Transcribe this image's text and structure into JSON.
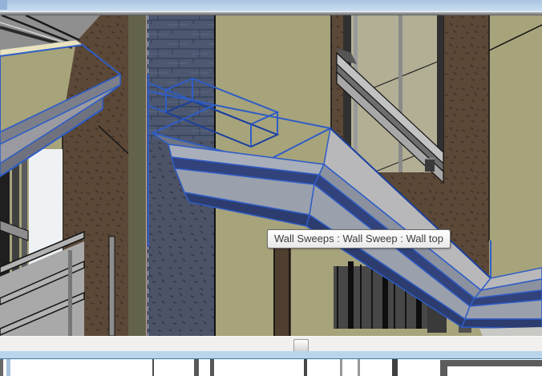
{
  "tooltip": {
    "text": "Wall Sweeps : Wall Sweep : Wall top"
  },
  "scrollbar": {
    "orientation": "horizontal",
    "thumb_position": "center"
  },
  "selection": {
    "category": "Wall Sweeps",
    "family": "Wall Sweep",
    "type": "Wall top"
  },
  "colors": {
    "selection_blue": "#2e5dc6",
    "selection_blue_dark": "#1b3f9c",
    "sky_top": "#a9c3e0",
    "sky_bottom": "#cadef2",
    "top_band_gray": "#8e9195",
    "wall_olive": "#a7a37b",
    "wall_olive_dark": "#63624a",
    "wall_brown": "#5b4837",
    "pier_blue_gray": "#4d5366",
    "surface_gray": "#b0b0b2",
    "surface_gray_mid": "#8b919f",
    "surface_navy": "#32427a",
    "cream": "#e9e3bf",
    "glass_white": "#eef2f5",
    "glass_olive": "#b2af94",
    "tooltip_border": "#6a6a6a",
    "tooltip_text": "#3c3c3c",
    "scroll_track": "#f1f0ee",
    "status_strip_blue": "#b9d5ec",
    "status_strip_edge": "#3e7ba0"
  }
}
